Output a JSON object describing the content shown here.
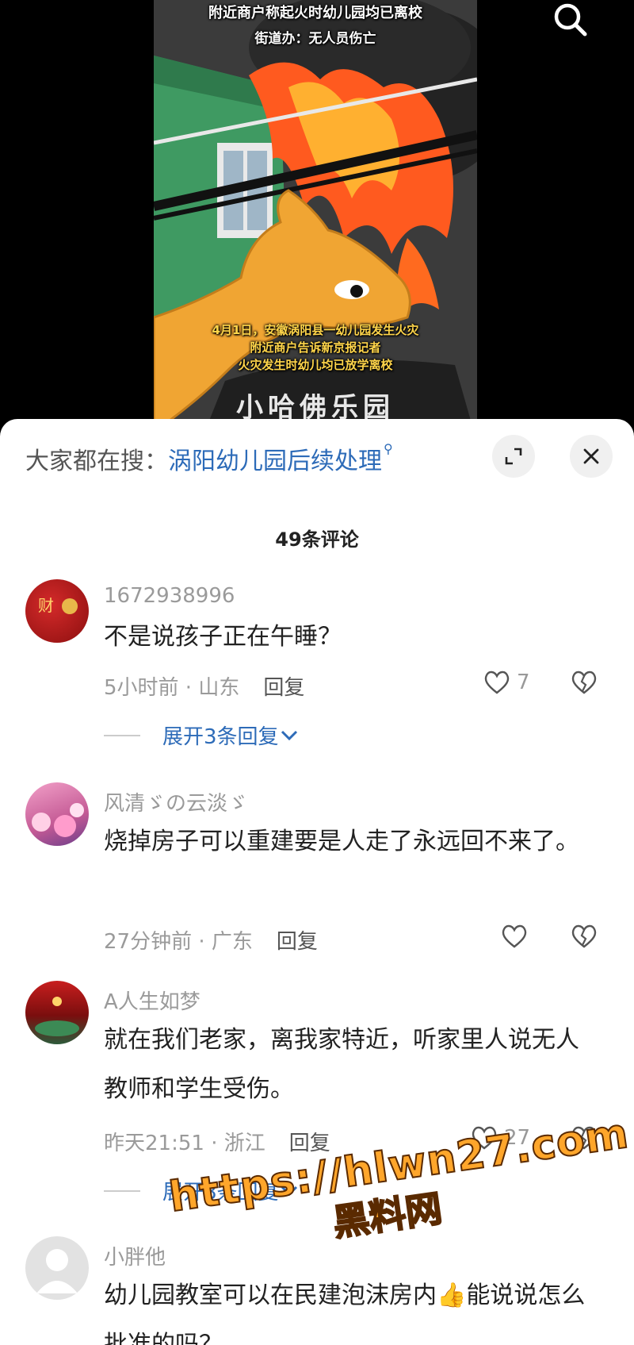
{
  "video": {
    "caption_top_1": "附近商户称起火时幼儿园均已离校",
    "caption_top_2": "街道办：无人员伤亡",
    "caption_bottom_1": "4月1日，安徽涡阳县一幼儿园发生火灾",
    "caption_bottom_2": "附近商户告诉新京报记者",
    "caption_bottom_3": "火灾发生时幼儿均已放学离校",
    "sign_text": "小哈佛乐园"
  },
  "sheet": {
    "trend_prefix": "大家都在搜：",
    "trend_query": "涡阳幼儿园后续处理",
    "comment_count": "49条评论"
  },
  "comments": [
    {
      "user": "1672938996",
      "text": "不是说孩子正在午睡？",
      "time_loc": "5小时前 · 山东",
      "reply": "回复",
      "likes": "7",
      "expand": "展开3条回复"
    },
    {
      "user": "风清ゞの云淡ゞ",
      "text": "烧掉房子可以重建要是人走了永远回不来了。",
      "time_loc": "27分钟前 · 广东",
      "reply": "回复",
      "likes": ""
    },
    {
      "user": "A人生如梦",
      "text": "就在我们老家，离我家特近，听家里人说无人教师和学生受伤。",
      "time_loc": "昨天21:51 · 浙江",
      "reply": "回复",
      "likes": "27",
      "expand": "展开8条回复"
    },
    {
      "user": "小胖他",
      "text": "幼儿园教室可以在民建泡沫房内👍能说说怎么批准的吗？",
      "time_loc": "",
      "reply": ""
    }
  ],
  "watermark": {
    "url": "https://hlwn27.com",
    "cn": "黑料网"
  },
  "colors": {
    "link_blue": "#2d6bb8",
    "meta_gray": "#9a9a9a",
    "watermark_orange": "#ffa62b"
  }
}
